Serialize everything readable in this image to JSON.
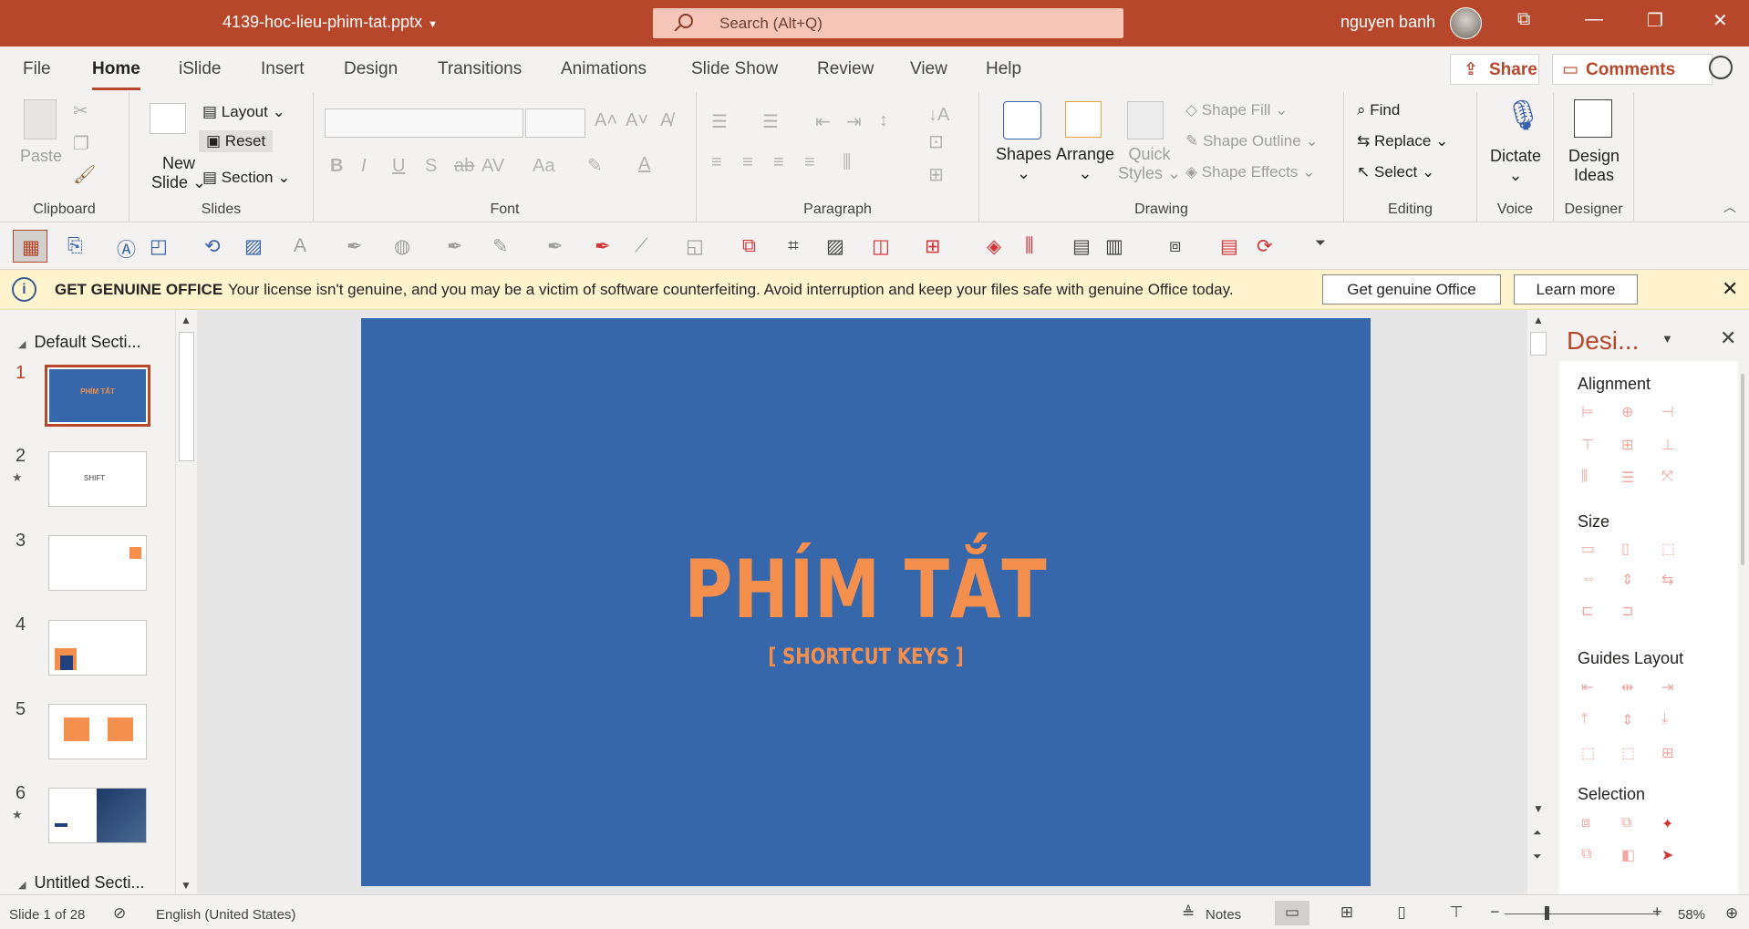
{
  "titlebar": {
    "doc_name": "4139-hoc-lieu-phim-tat.pptx",
    "search_placeholder": "Search (Alt+Q)",
    "user_name": "nguyen banh",
    "accent": "#b7472a"
  },
  "menu": {
    "items": [
      "File",
      "Home",
      "iSlide",
      "Insert",
      "Design",
      "Transitions",
      "Animations",
      "Slide Show",
      "Review",
      "View",
      "Help"
    ],
    "share_label": "Share",
    "comments_label": "Comments"
  },
  "ribbon": {
    "clipboard": {
      "paste": "Paste",
      "label": "Clipboard"
    },
    "slides": {
      "new_slide": "New",
      "new_slide2": "Slide",
      "layout": "Layout",
      "reset": "Reset",
      "section": "Section",
      "label": "Slides"
    },
    "font": {
      "label": "Font"
    },
    "paragraph": {
      "label": "Paragraph"
    },
    "drawing": {
      "shapes": "Shapes",
      "arrange": "Arrange",
      "quick_styles": "Quick",
      "quick_styles2": "Styles",
      "shape_fill": "Shape Fill",
      "shape_outline": "Shape Outline",
      "shape_effects": "Shape Effects",
      "label": "Drawing"
    },
    "editing": {
      "find": "Find",
      "replace": "Replace",
      "select": "Select",
      "label": "Editing"
    },
    "voice": {
      "dictate": "Dictate",
      "label": "Voice"
    },
    "designer": {
      "design_ideas": "Design",
      "design_ideas2": "Ideas",
      "label": "Designer"
    }
  },
  "message_bar": {
    "title": "GET GENUINE OFFICE",
    "text": "Your license isn't genuine, and you may be a victim of software counterfeiting. Avoid interruption and keep your files safe with genuine Office today.",
    "btn_primary": "Get genuine Office",
    "btn_secondary": "Learn more"
  },
  "thumbnails": {
    "section1": "Default Secti...",
    "section2": "Untitled Secti...",
    "slides": [
      {
        "num": "1",
        "text": "PHÍM TẮT"
      },
      {
        "num": "2",
        "text": "SHIFT"
      },
      {
        "num": "3",
        "text": ""
      },
      {
        "num": "4",
        "text": ""
      },
      {
        "num": "5",
        "text": ""
      },
      {
        "num": "6",
        "text": ""
      }
    ]
  },
  "slide": {
    "title": "PHÍM TẮT",
    "subtitle": "[ SHORTCUT KEYS ]",
    "bg_color": "#3767ab",
    "text_color": "#f58f4d"
  },
  "design_pane": {
    "title": "Desi...",
    "sections": [
      "Alignment",
      "Size",
      "Guides Layout",
      "Selection"
    ]
  },
  "status": {
    "slide_info": "Slide 1 of 28",
    "language": "English (United States)",
    "notes": "Notes",
    "zoom": "58%"
  }
}
